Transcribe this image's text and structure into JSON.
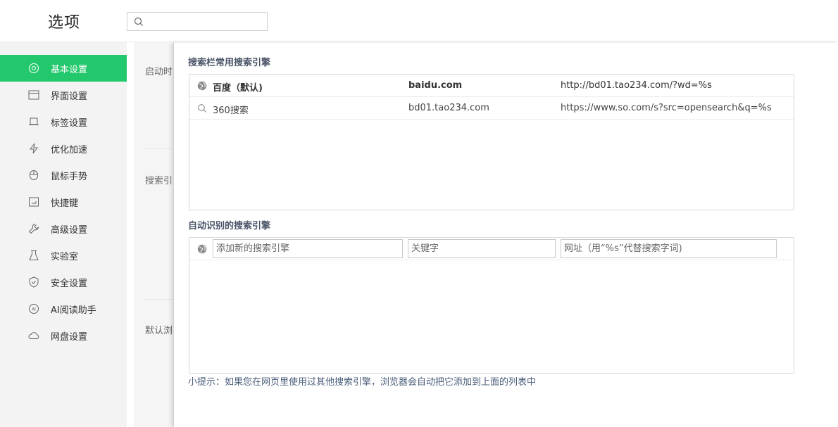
{
  "header": {
    "title": "选项",
    "search": {
      "value": "",
      "placeholder": ""
    }
  },
  "sidebar": {
    "items": [
      {
        "label": "基本设置",
        "icon": "settings-icon",
        "active": true
      },
      {
        "label": "界面设置",
        "icon": "window-icon",
        "active": false
      },
      {
        "label": "标签设置",
        "icon": "tab-icon",
        "active": false
      },
      {
        "label": "优化加速",
        "icon": "lightning-icon",
        "active": false
      },
      {
        "label": "鼠标手势",
        "icon": "mouse-icon",
        "active": false
      },
      {
        "label": "快捷键",
        "icon": "keyboard-icon",
        "active": false
      },
      {
        "label": "高级设置",
        "icon": "wrench-icon",
        "active": false
      },
      {
        "label": "实验室",
        "icon": "flask-icon",
        "active": false
      },
      {
        "label": "安全设置",
        "icon": "shield-icon",
        "active": false
      },
      {
        "label": "AI阅读助手",
        "icon": "ai-icon",
        "active": false
      },
      {
        "label": "网盘设置",
        "icon": "cloud-icon",
        "active": false
      }
    ],
    "accent_color": "#23c86c"
  },
  "background_panel": {
    "labels": [
      "启动时",
      "搜索引",
      "默认浏"
    ]
  },
  "dialog": {
    "common_section_title": "搜索栏常用搜索引擎",
    "common_engines": [
      {
        "name": "百度（默认)",
        "keyword": "baidu.com",
        "url": "http://bd01.tao234.com/?wd=%s",
        "icon": "globe-icon",
        "bold": true
      },
      {
        "name": "360搜索",
        "keyword": "bd01.tao234.com",
        "url": "https://www.so.com/s?src=opensearch&q=%s",
        "icon": "search-icon",
        "bold": false
      }
    ],
    "auto_section_title": "自动识别的搜索引擎",
    "add_row": {
      "name_placeholder": "添加新的搜索引擎",
      "keyword_placeholder": "关键字",
      "url_placeholder": "网址（用“%s”代替搜索字词)"
    },
    "tip": "小提示：如果您在网页里使用过其他搜索引擎，浏览器会自动把它添加到上面的列表中"
  }
}
